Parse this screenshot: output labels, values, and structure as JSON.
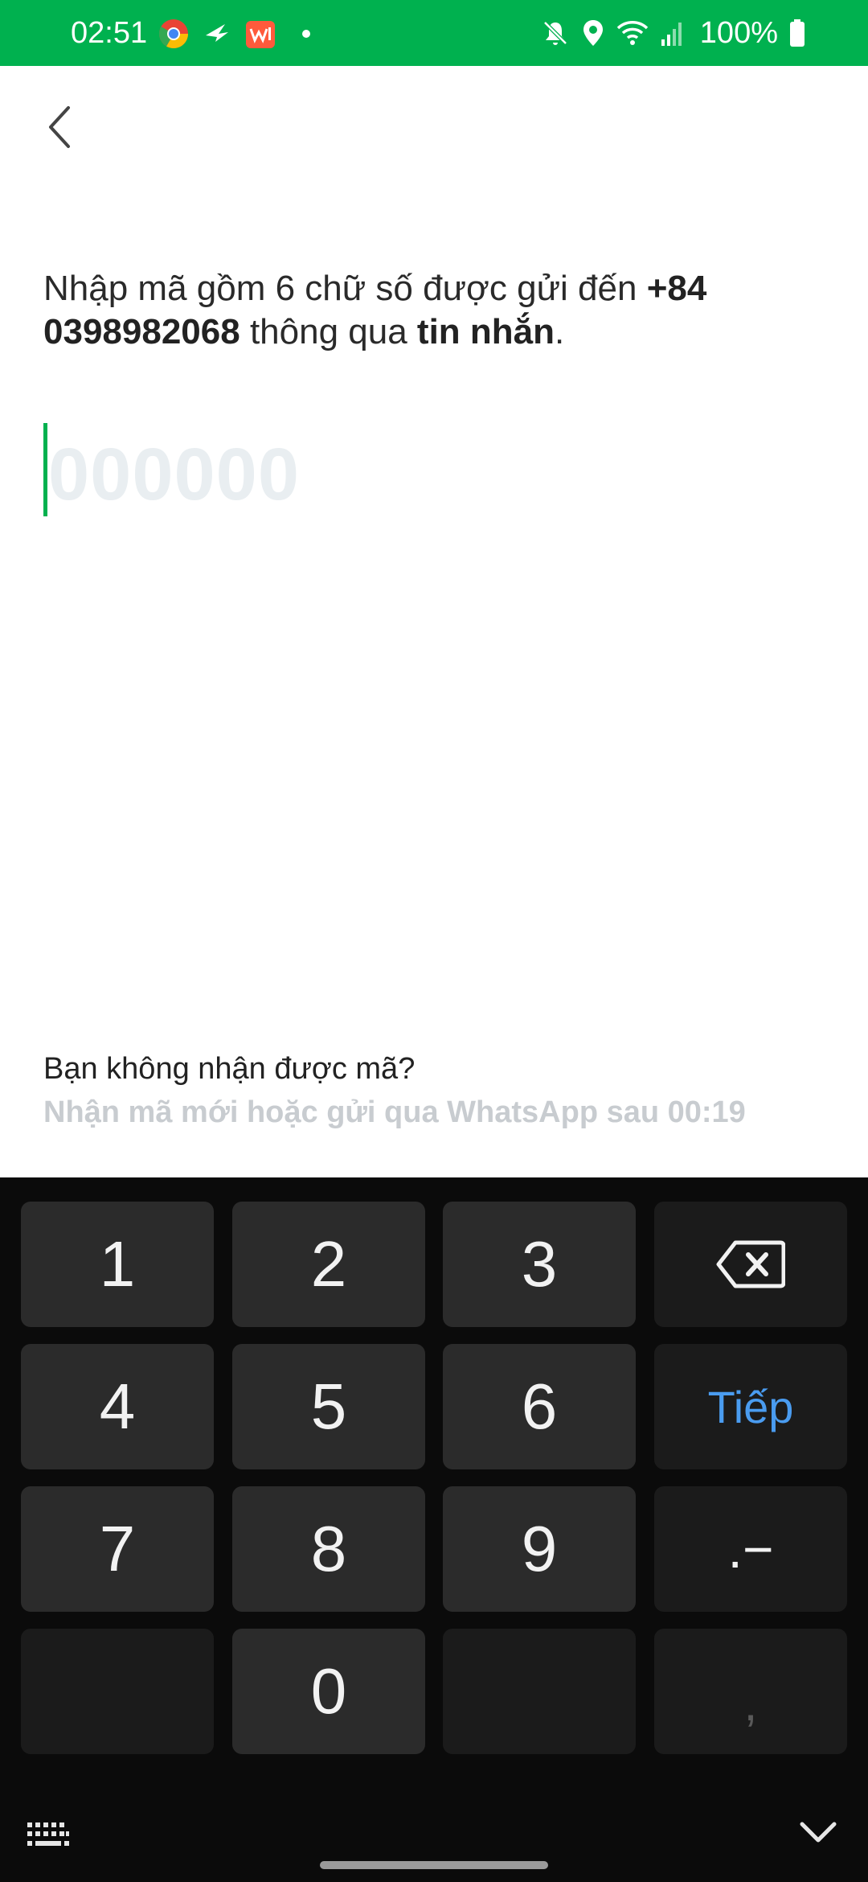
{
  "status_bar": {
    "time": "02:51",
    "battery": "100%",
    "icons": [
      "chrome-icon",
      "bird-icon",
      "shopping-app-icon",
      "notification-dot",
      "mute-icon",
      "location-icon",
      "wifi-icon",
      "signal-icon",
      "battery-icon"
    ],
    "accent_color": "#00b14f"
  },
  "header": {
    "back_icon": "chevron-left-icon"
  },
  "instruction": {
    "prefix": "Nhập mã gồm 6 chữ số được gửi đến ",
    "phone": "+84 0398982068",
    "middle": " thông qua ",
    "channel": "tin nhắn",
    "suffix": "."
  },
  "otp": {
    "placeholder": "000000",
    "value": ""
  },
  "resend": {
    "question": "Bạn không nhận được mã?",
    "hint": "Nhận mã mới hoặc gửi qua WhatsApp sau 00:19"
  },
  "keyboard": {
    "keys": {
      "k1": "1",
      "k2": "2",
      "k3": "3",
      "k4": "4",
      "k5": "5",
      "k6": "6",
      "k7": "7",
      "k8": "8",
      "k9": "9",
      "k0": "0",
      "next": "Tiếp",
      "punct": ".−",
      "comma": ","
    },
    "icons": [
      "backspace-icon",
      "keyboard-toggle-icon",
      "hide-keyboard-icon"
    ]
  }
}
